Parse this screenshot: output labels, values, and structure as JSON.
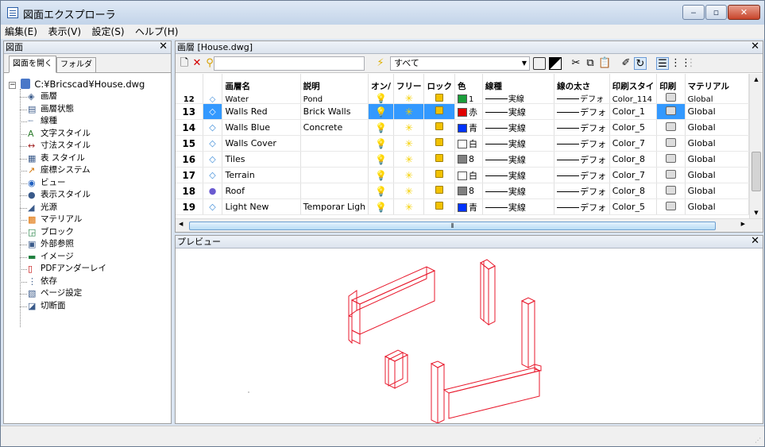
{
  "window": {
    "title": "図面エクスプローラ",
    "min": "▭",
    "max": "▢",
    "close": "✕"
  },
  "menu": [
    "編集(E)",
    "表示(V)",
    "設定(S)",
    "ヘルプ(H)"
  ],
  "left_panel": {
    "header": "図面",
    "close": "✕",
    "tabs": [
      "図面を開く",
      "フォルダ"
    ],
    "root": "C:¥Bricscad¥House.dwg",
    "items": [
      {
        "label": "画層",
        "icon": "layers-icon"
      },
      {
        "label": "画層状態",
        "icon": "layer-states-icon"
      },
      {
        "label": "線種",
        "icon": "linetype-icon"
      },
      {
        "label": "文字スタイル",
        "icon": "text-style-icon"
      },
      {
        "label": "寸法スタイル",
        "icon": "dimension-style-icon"
      },
      {
        "label": "表 スタイル",
        "icon": "table-style-icon"
      },
      {
        "label": "座標システム",
        "icon": "ucs-icon"
      },
      {
        "label": "ビュー",
        "icon": "view-icon"
      },
      {
        "label": "表示スタイル",
        "icon": "visual-style-icon"
      },
      {
        "label": "光源",
        "icon": "light-icon"
      },
      {
        "label": "マテリアル",
        "icon": "material-icon"
      },
      {
        "label": "ブロック",
        "icon": "block-icon"
      },
      {
        "label": "外部参照",
        "icon": "xref-icon"
      },
      {
        "label": "イメージ",
        "icon": "image-icon"
      },
      {
        "label": "PDFアンダーレイ",
        "icon": "pdf-underlay-icon"
      },
      {
        "label": "依存",
        "icon": "dependency-icon"
      },
      {
        "label": "ページ設定",
        "icon": "page-setup-icon"
      },
      {
        "label": "切断面",
        "icon": "section-plane-icon"
      }
    ]
  },
  "layer_panel": {
    "header": "画層 [House.dwg]",
    "close": "✕",
    "search_value": "",
    "filter_value": "すべて",
    "columns": [
      "",
      "",
      "画層名",
      "説明",
      "オン/",
      "フリー",
      "ロック",
      "色",
      "線種",
      "線の太さ",
      "印刷スタイ",
      "印刷",
      "マテリアル"
    ],
    "rows": [
      {
        "num": "12",
        "name": "Water",
        "desc": "Pond",
        "on": true,
        "color_hex": "#1a9e3a",
        "color_name": "1",
        "linetype": "実線",
        "lineweight": "デフォ",
        "plotstyle": "Color_114",
        "material": "Global",
        "icon": "layer-icon",
        "selected": false
      },
      {
        "num": "13",
        "name": "Walls Red",
        "desc": "Brick Walls",
        "on": true,
        "color_hex": "#e00000",
        "color_name": "赤",
        "linetype": "実線",
        "lineweight": "デフォ",
        "plotstyle": "Color_1",
        "material": "Global",
        "icon": "layer-icon",
        "selected": true
      },
      {
        "num": "14",
        "name": "Walls Blue",
        "desc": "Concrete",
        "on": true,
        "color_hex": "#0033ff",
        "color_name": "青",
        "linetype": "実線",
        "lineweight": "デフォ",
        "plotstyle": "Color_5",
        "material": "Global",
        "icon": "layer-icon",
        "selected": false
      },
      {
        "num": "15",
        "name": "Walls Cover",
        "desc": "",
        "on": true,
        "color_hex": "#ffffff",
        "color_name": "白",
        "linetype": "実線",
        "lineweight": "デフォ",
        "plotstyle": "Color_7",
        "material": "Global",
        "icon": "layer-icon",
        "selected": false
      },
      {
        "num": "16",
        "name": "Tiles",
        "desc": "",
        "on": true,
        "color_hex": "#808080",
        "color_name": "8",
        "linetype": "実線",
        "lineweight": "デフォ",
        "plotstyle": "Color_8",
        "material": "Global",
        "icon": "layer-icon",
        "selected": false
      },
      {
        "num": "17",
        "name": "Terrain",
        "desc": "",
        "on": true,
        "color_hex": "#ffffff",
        "color_name": "白",
        "linetype": "実線",
        "lineweight": "デフォ",
        "plotstyle": "Color_7",
        "material": "Global",
        "icon": "layer-icon",
        "selected": false
      },
      {
        "num": "18",
        "name": "Roof",
        "desc": "",
        "on": false,
        "color_hex": "#808080",
        "color_name": "8",
        "linetype": "実線",
        "lineweight": "デフォ",
        "plotstyle": "Color_8",
        "material": "Global",
        "icon": "current-layer-icon",
        "selected": false
      },
      {
        "num": "19",
        "name": "Light New",
        "desc": "Temporar Ligh",
        "on": true,
        "color_hex": "#0033ff",
        "color_name": "青",
        "linetype": "実線",
        "lineweight": "デフォ",
        "plotstyle": "Color_5",
        "material": "Global",
        "icon": "layer-icon",
        "selected": false
      }
    ]
  },
  "preview": {
    "header": "プレビュー",
    "close": "✕"
  },
  "colors": {
    "accent": "#3399ff",
    "wireframe": "#e8192c"
  }
}
